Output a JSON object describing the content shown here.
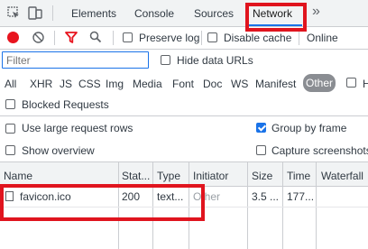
{
  "tabs": {
    "elements": "Elements",
    "console": "Console",
    "sources": "Sources",
    "network": "Network",
    "more": "»"
  },
  "toolbar": {
    "preserve_log": "Preserve log",
    "disable_cache": "Disable cache",
    "throttling": "Online"
  },
  "filter": {
    "placeholder": "Filter",
    "hide_data_urls": "Hide data URLs"
  },
  "type_filters": [
    "All",
    "XHR",
    "JS",
    "CSS",
    "Img",
    "Media",
    "Font",
    "Doc",
    "WS",
    "Manifest",
    "Other",
    "H"
  ],
  "type_filter_selected": "Other",
  "blocked_requests": "Blocked Requests",
  "settings": {
    "large_rows": "Use large request rows",
    "group_by_frame": "Group by frame",
    "show_overview": "Show overview",
    "capture_screenshots": "Capture screenshots"
  },
  "table": {
    "columns": [
      "Name",
      "Stat...",
      "Type",
      "Initiator",
      "Size",
      "Time",
      "Waterfall"
    ],
    "rows": [
      {
        "name": "favicon.ico",
        "status": "200",
        "type": "text...",
        "initiator": "Other",
        "size": "3.5 ...",
        "time": "177..."
      }
    ]
  },
  "colors": {
    "accent": "#1a73e8",
    "record": "#e8141e",
    "annotation": "#e0141e"
  }
}
